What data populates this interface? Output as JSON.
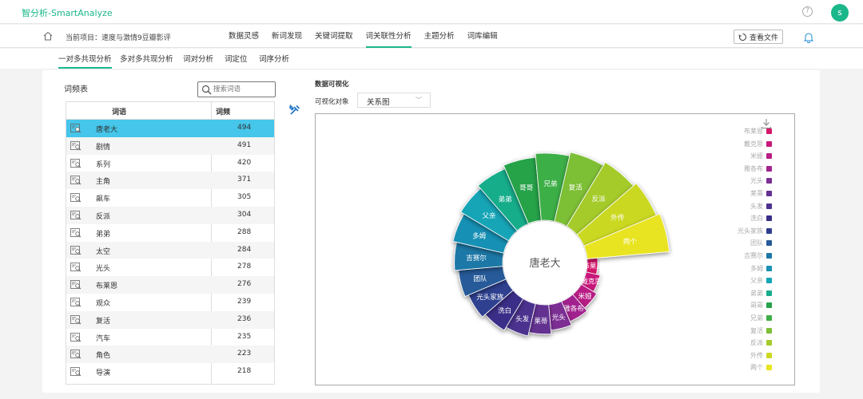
{
  "app": {
    "title": "智分析-SmartAnalyze",
    "help_icon": "help-circle-icon",
    "user_initial": "s"
  },
  "nav": {
    "project_text": "当前项目：速度与激情9豆瓣影评",
    "tabs": [
      {
        "label": "数据灵感"
      },
      {
        "label": "新词发现"
      },
      {
        "label": "关键词提取"
      },
      {
        "label": "词关联性分析"
      },
      {
        "label": "主题分析"
      },
      {
        "label": "词库编辑"
      }
    ],
    "active_tab": "词关联性分析",
    "view_file_label": "查看文件"
  },
  "subtabs": [
    {
      "label": "一对多共现分析"
    },
    {
      "label": "多对多共现分析"
    },
    {
      "label": "词对分析"
    },
    {
      "label": "词定位"
    },
    {
      "label": "词序分析"
    }
  ],
  "active_subtab": "一对多共现分析",
  "wordfreq": {
    "title": "词频表",
    "search_placeholder": "搜索词语",
    "col_word": "词语",
    "col_freq": "词频",
    "rows": [
      {
        "word": "唐老大",
        "freq": "494"
      },
      {
        "word": "剧情",
        "freq": "491"
      },
      {
        "word": "系列",
        "freq": "420"
      },
      {
        "word": "主角",
        "freq": "371"
      },
      {
        "word": "飙车",
        "freq": "305"
      },
      {
        "word": "反派",
        "freq": "304"
      },
      {
        "word": "弟弟",
        "freq": "288"
      },
      {
        "word": "太空",
        "freq": "284"
      },
      {
        "word": "光头",
        "freq": "278"
      },
      {
        "word": "布莱恩",
        "freq": "276"
      },
      {
        "word": "观众",
        "freq": "239"
      },
      {
        "word": "复活",
        "freq": "236"
      },
      {
        "word": "汽车",
        "freq": "235"
      },
      {
        "word": "角色",
        "freq": "223"
      },
      {
        "word": "导演",
        "freq": "218"
      }
    ]
  },
  "viz": {
    "title": "数据可视化",
    "target_label": "可视化对象",
    "selected": "关系图"
  },
  "chart_data": {
    "type": "pie",
    "center_label": "唐老大",
    "series": [
      {
        "name": "布莱恩",
        "value": 3,
        "color": "#d6186b"
      },
      {
        "name": "戴克思",
        "value": 4,
        "color": "#c8177a"
      },
      {
        "name": "米娅",
        "value": 5,
        "color": "#b81e84"
      },
      {
        "name": "雅各布",
        "value": 6,
        "color": "#a1238f"
      },
      {
        "name": "光头",
        "value": 7,
        "color": "#7b2f93"
      },
      {
        "name": "莱蒂",
        "value": 8,
        "color": "#643091"
      },
      {
        "name": "头发",
        "value": 9,
        "color": "#4c318e"
      },
      {
        "name": "洗白",
        "value": 10,
        "color": "#3a2f88"
      },
      {
        "name": "光头家族",
        "value": 11,
        "color": "#2f3f8f"
      },
      {
        "name": "团队",
        "value": 12,
        "color": "#275a98"
      },
      {
        "name": "吉赛尔",
        "value": 13,
        "color": "#1d78a6"
      },
      {
        "name": "多姆",
        "value": 14,
        "color": "#1890b4"
      },
      {
        "name": "父亲",
        "value": 15,
        "color": "#13a5b6"
      },
      {
        "name": "弟弟",
        "value": 16,
        "color": "#17ad8b"
      },
      {
        "name": "哥哥",
        "value": 17,
        "color": "#27a24a"
      },
      {
        "name": "兄弟",
        "value": 18,
        "color": "#3daf46"
      },
      {
        "name": "复活",
        "value": 19,
        "color": "#7dbf36"
      },
      {
        "name": "反派",
        "value": 20,
        "color": "#a5cb2b"
      },
      {
        "name": "外传",
        "value": 21,
        "color": "#cbd824"
      },
      {
        "name": "两个",
        "value": 22,
        "color": "#e9e421"
      }
    ]
  }
}
